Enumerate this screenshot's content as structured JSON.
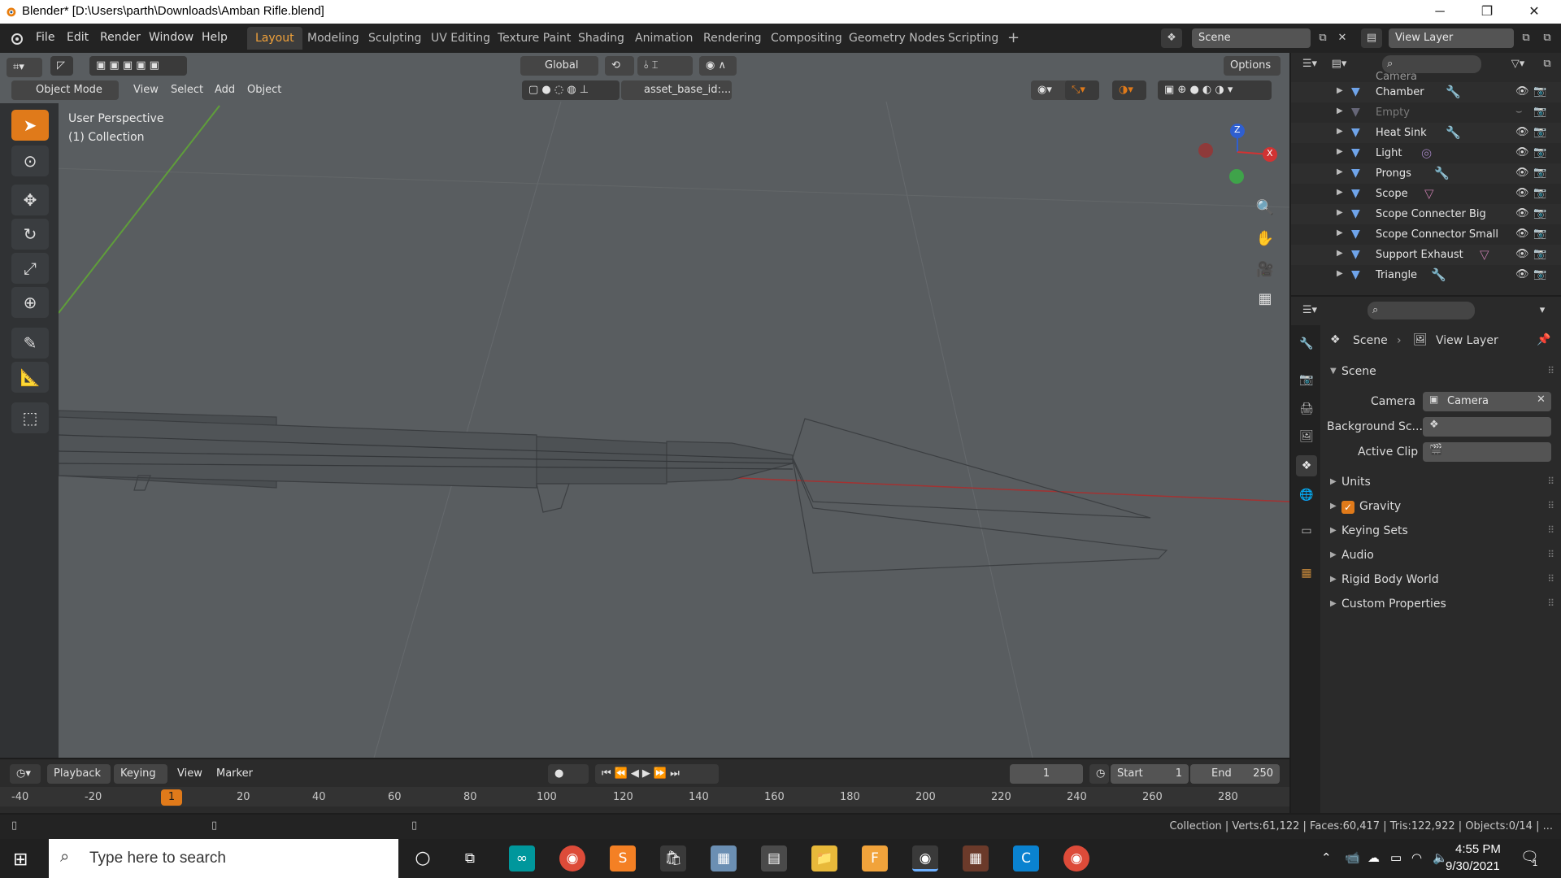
{
  "window": {
    "title": "Blender* [D:\\Users\\parth\\Downloads\\Amban Rifle.blend]",
    "controls": [
      "─",
      "❐",
      "✕"
    ]
  },
  "menu": {
    "items": [
      "File",
      "Edit",
      "Render",
      "Window",
      "Help"
    ],
    "workspaces": [
      "Layout",
      "Modeling",
      "Sculpting",
      "UV Editing",
      "Texture Paint",
      "Shading",
      "Animation",
      "Rendering",
      "Compositing",
      "Geometry Nodes",
      "Scripting",
      "+"
    ],
    "active_workspace": "Layout",
    "scene_name": "Scene",
    "view_layer": "View Layer"
  },
  "viewport_header": {
    "transform_orientation": "Global",
    "options_label": "Options",
    "mode": "Object Mode",
    "menus": [
      "View",
      "Select",
      "Add",
      "Object"
    ],
    "asset_field": "asset_base_id:..."
  },
  "viewport": {
    "perspective_label": "User Perspective",
    "collection_label": "(1) Collection",
    "axis_x": "X",
    "axis_z": "Z",
    "accent_orange": "#e07a1a"
  },
  "outliner": {
    "partial_top": "Camera",
    "rows": [
      {
        "name": "Chamber",
        "disabled": false
      },
      {
        "name": "Empty",
        "disabled": true
      },
      {
        "name": "Heat Sink",
        "disabled": false
      },
      {
        "name": "Light",
        "disabled": false
      },
      {
        "name": "Prongs",
        "disabled": false
      },
      {
        "name": "Scope",
        "disabled": false
      },
      {
        "name": "Scope Connecter Big",
        "disabled": false
      },
      {
        "name": "Scope Connector Small",
        "disabled": false
      },
      {
        "name": "Support Exhaust",
        "disabled": false
      },
      {
        "name": "Triangle",
        "disabled": false
      }
    ]
  },
  "properties": {
    "breadcrumb_scene": "Scene",
    "breadcrumb_view_layer": "View Layer",
    "section_title": "Scene",
    "camera_label": "Camera",
    "camera_value": "Camera",
    "background_label": "Background Sc...",
    "active_clip_label": "Active Clip",
    "panels": [
      "Units",
      "Gravity",
      "Keying Sets",
      "Audio",
      "Rigid Body World",
      "Custom Properties"
    ],
    "gravity_checked": true
  },
  "timeline": {
    "menus": [
      "Playback",
      "Keying",
      "View",
      "Marker"
    ],
    "current_frame": "1",
    "start_label": "Start",
    "start_value": "1",
    "end_label": "End",
    "end_value": "250",
    "ruler_ticks": [
      "-40",
      "-20",
      "1",
      "20",
      "40",
      "60",
      "80",
      "100",
      "120",
      "140",
      "160",
      "180",
      "200",
      "220",
      "240",
      "260",
      "280"
    ]
  },
  "statusbar": {
    "stats": "Collection | Verts:61,122 | Faces:60,417 | Tris:122,922 | Objects:0/14 | ..."
  },
  "taskbar": {
    "search_placeholder": "Type here to search",
    "time": "4:55 PM",
    "date": "9/30/2021",
    "notification_count": "1"
  }
}
